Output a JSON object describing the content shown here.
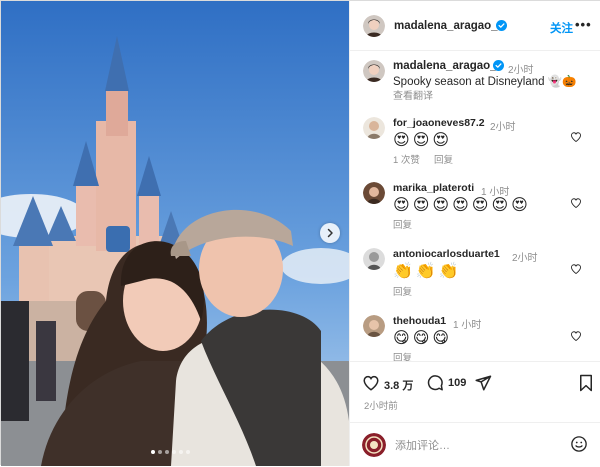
{
  "post": {
    "author": "madalena_aragao_",
    "follow_label": "关注",
    "more_label": "•••",
    "caption_time": "2小时",
    "caption_text": "Spooky season at Disneyland 👻🎃",
    "translate_label": "查看翻译",
    "photo_count": 6,
    "active_photo": 0
  },
  "comments": [
    {
      "user": "for_joaoneves87.2",
      "time": "2小时",
      "emojis": [
        "😍",
        "😍",
        "😍"
      ],
      "likes_label": "1 次赞",
      "reply_label": "回复"
    },
    {
      "user": "marika_plateroti",
      "time": "1 小时",
      "emojis": [
        "😍",
        "😍",
        "😍",
        "😍",
        "😍",
        "😍",
        "😍"
      ],
      "reply_label": "回复"
    },
    {
      "user": "antoniocarlosduarte1",
      "time": "2小时",
      "emojis": [
        "👏",
        "👏",
        "👏"
      ],
      "reply_label": "回复"
    },
    {
      "user": "thehouda1",
      "time": "1 小时",
      "emojis": [
        "😋",
        "😋",
        "😋"
      ],
      "reply_label": "回复"
    }
  ],
  "actions": {
    "likes_count": "3.8 万",
    "comments_count": "109",
    "post_time": "2小时前"
  },
  "composer": {
    "placeholder": "添加评论…"
  },
  "colors": {
    "accent": "#0095f6",
    "verified": "#0095f6",
    "muted": "#8e8e8e"
  },
  "icons": [
    "verified-badge-icon",
    "heart-icon",
    "comment-icon",
    "share-icon",
    "bookmark-icon",
    "emoji-icon",
    "chevron-right-icon",
    "more-icon"
  ]
}
